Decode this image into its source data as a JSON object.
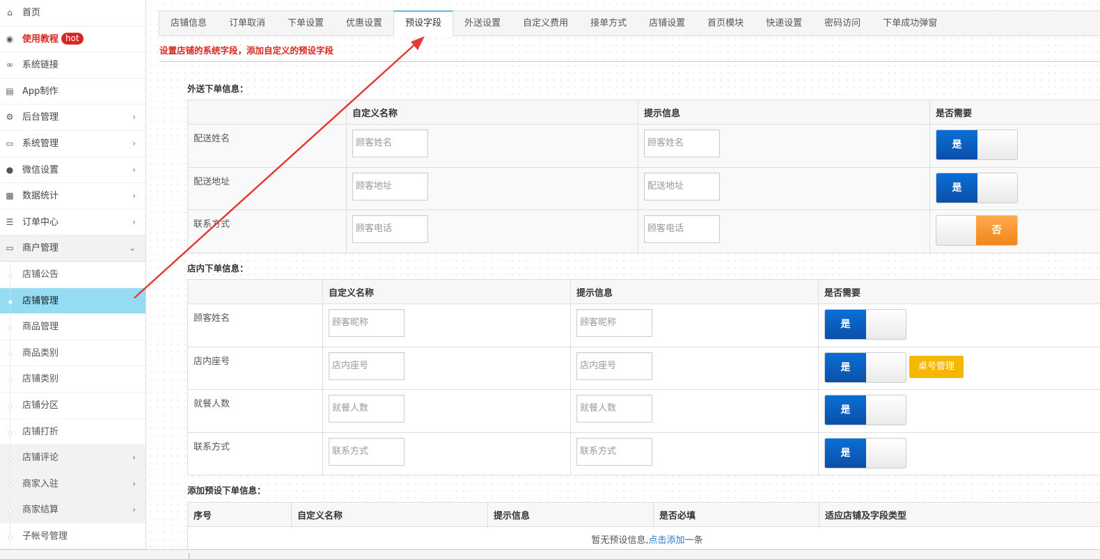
{
  "sidebar": {
    "items": [
      {
        "label": "首页",
        "icon": "home-icon"
      },
      {
        "label": "使用教程",
        "icon": "play-icon",
        "badge": "hot"
      },
      {
        "label": "系统链接",
        "icon": "link-icon"
      },
      {
        "label": "App制作",
        "icon": "file-icon"
      },
      {
        "label": "后台管理",
        "icon": "cogs-icon"
      },
      {
        "label": "系统管理",
        "icon": "desktop-icon"
      },
      {
        "label": "微信设置",
        "icon": "chat-icon"
      },
      {
        "label": "数据统计",
        "icon": "bar-chart-icon"
      },
      {
        "label": "订单中心",
        "icon": "server-icon"
      },
      {
        "label": "商户管理",
        "icon": "laptop-icon"
      }
    ],
    "sub_items": [
      {
        "label": "店铺公告"
      },
      {
        "label": "店铺管理"
      },
      {
        "label": "商品管理"
      },
      {
        "label": "商品类别"
      },
      {
        "label": "店铺类别"
      },
      {
        "label": "店铺分区"
      },
      {
        "label": "店铺打折"
      },
      {
        "label": "店铺评论"
      },
      {
        "label": "商家入驻"
      },
      {
        "label": "商家结算"
      },
      {
        "label": "子帐号管理"
      }
    ]
  },
  "tabs": [
    "店铺信息",
    "订单取消",
    "下单设置",
    "优惠设置",
    "预设字段",
    "外送设置",
    "自定义费用",
    "接单方式",
    "店铺设置",
    "首页模块",
    "快递设置",
    "密码访问",
    "下单成功弹窗"
  ],
  "active_tab": "预设字段",
  "hint": "设置店铺的系统字段，添加自定义的预设字段",
  "delivery": {
    "title": "外送下单信息：",
    "headers": {
      "name": "自定义名称",
      "tip": "提示信息",
      "required": "是否需要"
    },
    "rows": [
      {
        "label": "配送姓名",
        "name_ph": "顾客姓名",
        "tip_ph": "顾客姓名",
        "state": "是"
      },
      {
        "label": "配送地址",
        "name_ph": "顾客地址",
        "tip_ph": "配送地址",
        "state": "是"
      },
      {
        "label": "联系方式",
        "name_ph": "顾客电话",
        "tip_ph": "顾客电话",
        "state": "否"
      }
    ]
  },
  "instore": {
    "title": "店内下单信息：",
    "headers": {
      "name": "自定义名称",
      "tip": "提示信息",
      "required": "是否需要"
    },
    "rows": [
      {
        "label": "顾客姓名",
        "name_ph": "顾客昵称",
        "tip_ph": "顾客昵称",
        "state": "是"
      },
      {
        "label": "店内座号",
        "name_ph": "店内座号",
        "tip_ph": "店内座号",
        "state": "是"
      },
      {
        "label": "就餐人数",
        "name_ph": "就餐人数",
        "tip_ph": "就餐人数",
        "state": "是"
      },
      {
        "label": "联系方式",
        "name_ph": "联系方式",
        "tip_ph": "联系方式",
        "state": "是"
      }
    ],
    "desk_button": "桌号管理"
  },
  "preset": {
    "title": "添加预设下单信息：",
    "headers": [
      "序号",
      "自定义名称",
      "提示信息",
      "是否必填",
      "适应店铺及字段类型"
    ],
    "empty_prefix": "暂无预设信息,",
    "empty_link": "点击添加",
    "empty_suffix": "一条"
  },
  "colors": {
    "accent_red": "#d9271f",
    "switch_on": "#0b5fc0",
    "switch_off": "#f0861b",
    "active_nav": "#95dcf3",
    "desk_button": "#f5b800"
  }
}
